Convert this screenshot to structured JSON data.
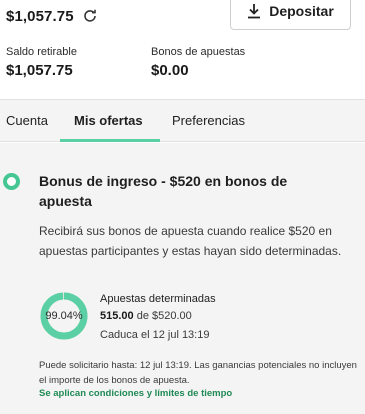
{
  "header": {
    "balance": "$1,057.75",
    "refresh_icon": "refresh-icon",
    "deposit_label": "Depositar",
    "deposit_icon": "download-icon"
  },
  "stats": {
    "withdrawable_label": "Saldo retirable",
    "withdrawable_value": "$1,057.75",
    "bonus_label": "Bonos de apuestas",
    "bonus_value": "$0.00"
  },
  "tabs": [
    {
      "label": "Cuenta",
      "active": false
    },
    {
      "label": "Mis ofertas",
      "active": true
    },
    {
      "label": "Preferencias",
      "active": false
    }
  ],
  "offer": {
    "title": "Bonus de ingreso - $520 en bonos de apuesta",
    "description": "Recibirá sus bonos de apuesta cuando realice $520 en apuestas participantes y estas hayan sido determinadas.",
    "progress_percent": 99.04,
    "progress_label": "99.04%",
    "wager_title": "Apuestas determinadas",
    "wager_done": "515.00",
    "wager_of": "de",
    "wager_total": "$520.00",
    "expiry": "Caduca el 12 jul 13:19",
    "note": "Puede solicitario hasta: 12 jul 13:19. Las ganancias potenciales no incluyen el importe de los bonos de apuesta.",
    "terms_link": "Se aplican condiciones y límites de tiempo"
  },
  "colors": {
    "accent": "#45c794",
    "tab_underline": "#5bd0a4",
    "link": "#1f8a55",
    "panel_bg": "#f4f4f4"
  }
}
